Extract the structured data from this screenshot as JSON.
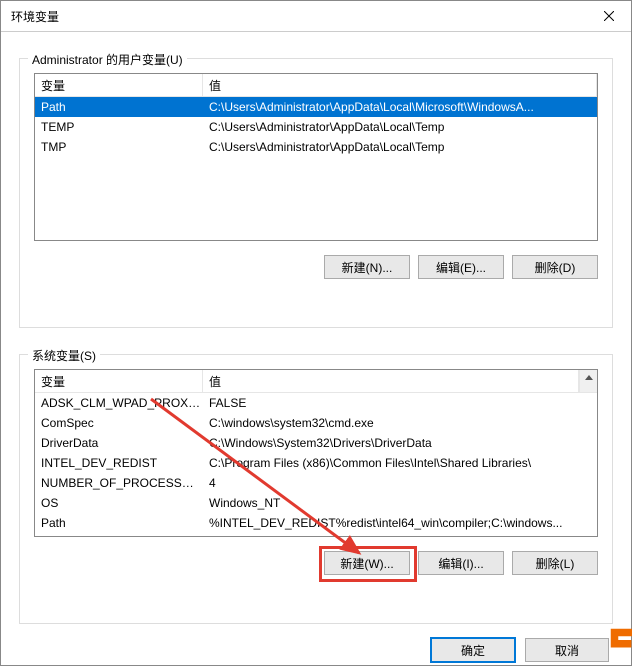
{
  "window": {
    "title": "环境变量"
  },
  "user_group": {
    "legend": "Administrator 的用户变量(U)",
    "headers": {
      "name": "变量",
      "value": "值"
    },
    "rows": [
      {
        "name": "Path",
        "value": "C:\\Users\\Administrator\\AppData\\Local\\Microsoft\\WindowsA...",
        "selected": true
      },
      {
        "name": "TEMP",
        "value": "C:\\Users\\Administrator\\AppData\\Local\\Temp",
        "selected": false
      },
      {
        "name": "TMP",
        "value": "C:\\Users\\Administrator\\AppData\\Local\\Temp",
        "selected": false
      }
    ],
    "buttons": {
      "new": "新建(N)...",
      "edit": "编辑(E)...",
      "delete": "删除(D)"
    }
  },
  "system_group": {
    "legend": "系统变量(S)",
    "headers": {
      "name": "变量",
      "value": "值"
    },
    "rows": [
      {
        "name": "ADSK_CLM_WPAD_PROXY...",
        "value": "FALSE"
      },
      {
        "name": "ComSpec",
        "value": "C:\\windows\\system32\\cmd.exe"
      },
      {
        "name": "DriverData",
        "value": "C:\\Windows\\System32\\Drivers\\DriverData"
      },
      {
        "name": "INTEL_DEV_REDIST",
        "value": "C:\\Program Files (x86)\\Common Files\\Intel\\Shared Libraries\\"
      },
      {
        "name": "NUMBER_OF_PROCESSORS",
        "value": "4"
      },
      {
        "name": "OS",
        "value": "Windows_NT"
      },
      {
        "name": "Path",
        "value": "%INTEL_DEV_REDIST%redist\\intel64_win\\compiler;C:\\windows..."
      }
    ],
    "buttons": {
      "new": "新建(W)...",
      "edit": "编辑(I)...",
      "delete": "删除(L)"
    }
  },
  "footer": {
    "ok": "确定",
    "cancel": "取消"
  },
  "annotations": {
    "highlight_on": "system-new-button",
    "arrow_color": "#e13a2f"
  }
}
